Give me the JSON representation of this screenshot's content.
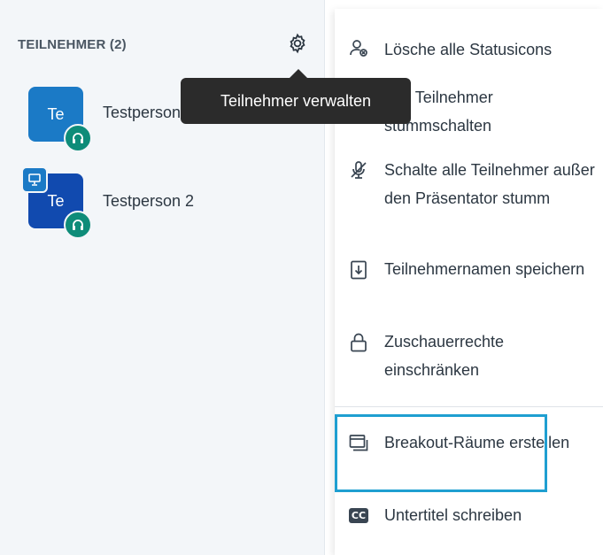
{
  "sidebar": {
    "title": "TEILNEHMER (2)",
    "users": [
      {
        "initials": "Te",
        "name": "Testperson 1",
        "presenter": false
      },
      {
        "initials": "Te",
        "name": "Testperson 2",
        "presenter": true
      }
    ]
  },
  "tooltip": {
    "text": "Teilnehmer verwalten"
  },
  "menu": {
    "items": [
      {
        "icon": "user-clear-status-icon",
        "label": "Lösche alle Statusicons"
      },
      {
        "icon": "mute-all-icon",
        "label": "Alle Teilnehmer stummschalten"
      },
      {
        "icon": "microphone-off-icon",
        "label": "Schalte alle Teilnehmer außer den Präsentator stumm"
      },
      {
        "icon": "download-file-icon",
        "label": "Teilnehmernamen speichern"
      },
      {
        "icon": "lock-icon",
        "label": "Zuschauerrechte einschränken"
      },
      {
        "icon": "breakout-rooms-icon",
        "label": "Breakout-Räume erstellen"
      },
      {
        "icon": "closed-captions-icon",
        "label": "Untertitel schreiben",
        "icon_text": "CC"
      }
    ]
  },
  "colors": {
    "highlight": "#1f9fd1",
    "avatar_1": "#1b7ac6",
    "avatar_2": "#114aaf",
    "status_green": "#0e8c79"
  }
}
